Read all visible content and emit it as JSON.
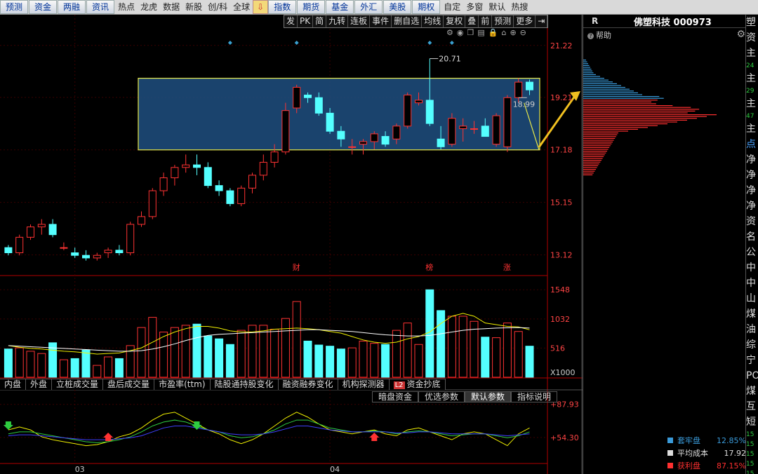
{
  "toolbar": {
    "buttons": [
      "预测",
      "资金",
      "两融",
      "资讯"
    ],
    "plain": [
      "热点",
      "龙虎",
      "数据",
      "新股",
      "创/科",
      "全球"
    ],
    "buttons2": [
      "指数",
      "期货",
      "基金",
      "外汇",
      "美股",
      "期权"
    ],
    "plain2": [
      "自定",
      "多窗",
      "默认",
      "热搜"
    ]
  },
  "chart_toolbar": [
    "发",
    "PK",
    "简",
    "九转",
    "连板",
    "事件",
    "删自选",
    "均线",
    "复权",
    "叠",
    "前",
    "预测",
    "更多"
  ],
  "icons": [
    "settings-icon",
    "eye-icon",
    "copy-icon",
    "print-icon",
    "lock-icon",
    "home-icon",
    "zoom-in-icon",
    "zoom-out-icon"
  ],
  "price_axis": [
    "21.22",
    "19.21",
    "17.18",
    "15.15",
    "13.12"
  ],
  "annotations": {
    "high": "20.71",
    "last": "18.99",
    "markers": [
      "财",
      "榜",
      "涨"
    ]
  },
  "volume_axis": [
    "1548",
    "1032",
    "516",
    "X1000"
  ],
  "osc_axis": [
    "+87.93",
    "+54.30"
  ],
  "date_labels": [
    "03",
    "04"
  ],
  "indicator_tabs": [
    "内盘",
    "外盘",
    "立桩成交量",
    "盘后成交量",
    "市盈率(ttm)",
    "陆股通持股变化",
    "融资融券变化",
    "机构探测器",
    "资金抄底"
  ],
  "l2_badge": "L2",
  "sub_tabs": [
    "暗盘资金",
    "优选参数",
    "默认参数",
    "指标说明"
  ],
  "right_panel": {
    "r_label": "R",
    "stock_name": "佛塑科技 000973",
    "help": "帮助",
    "legend": [
      {
        "label": "套牢盘",
        "value": "12.85%",
        "color": "#3a9ad9"
      },
      {
        "label": "平均成本",
        "value": "17.92",
        "color": "#dddddd"
      },
      {
        "label": "获利盘",
        "value": "87.15%",
        "color": "#ff3030"
      }
    ]
  },
  "far_right": [
    "塑",
    "资",
    "主",
    "24",
    "主",
    "29",
    "主",
    "47",
    "主",
    "点",
    "净",
    "净",
    "净",
    "净",
    "资",
    "名",
    "公",
    "中",
    "中",
    "山",
    "煤",
    "油",
    "综",
    "宁",
    "PO",
    "煤",
    "互",
    "短",
    "15",
    "15",
    "15",
    "15",
    "15"
  ],
  "colors": {
    "up": "#ff3333",
    "down": "#54ffff",
    "box_fill": "#1f4f80",
    "box_border": "#e8e84a",
    "arrow": "#f0c020"
  },
  "chart_data": {
    "type": "candlestick",
    "candles": [
      [
        13.4,
        13.5,
        13.1,
        13.2
      ],
      [
        13.2,
        13.9,
        13.1,
        13.8
      ],
      [
        13.8,
        14.3,
        13.7,
        14.2
      ],
      [
        14.2,
        14.5,
        13.9,
        14.3
      ],
      [
        14.3,
        14.5,
        13.8,
        13.9
      ],
      [
        13.4,
        13.6,
        13.3,
        13.4
      ],
      [
        13.2,
        13.4,
        13.0,
        13.1
      ],
      [
        13.1,
        13.3,
        12.9,
        13.0
      ],
      [
        13.0,
        13.2,
        12.9,
        13.1
      ],
      [
        13.2,
        13.4,
        13.0,
        13.3
      ],
      [
        13.3,
        13.5,
        13.1,
        13.2
      ],
      [
        13.2,
        14.4,
        13.1,
        14.3
      ],
      [
        14.3,
        14.8,
        14.2,
        14.6
      ],
      [
        14.6,
        15.7,
        14.5,
        15.6
      ],
      [
        15.6,
        16.3,
        15.4,
        16.1
      ],
      [
        16.1,
        16.6,
        15.8,
        16.5
      ],
      [
        16.5,
        17.0,
        16.3,
        16.6
      ],
      [
        16.6,
        17.0,
        16.2,
        16.5
      ],
      [
        16.5,
        16.7,
        15.7,
        15.8
      ],
      [
        15.8,
        16.0,
        15.4,
        15.6
      ],
      [
        15.6,
        15.7,
        15.0,
        15.1
      ],
      [
        15.1,
        15.8,
        15.0,
        15.7
      ],
      [
        15.7,
        16.3,
        15.5,
        16.2
      ],
      [
        16.2,
        17.0,
        16.0,
        16.7
      ],
      [
        16.7,
        17.4,
        16.5,
        17.1
      ],
      [
        17.1,
        19.0,
        17.0,
        18.7
      ],
      [
        18.8,
        19.7,
        18.6,
        19.6
      ],
      [
        19.3,
        19.4,
        19.0,
        19.2
      ],
      [
        19.2,
        19.4,
        18.5,
        18.6
      ],
      [
        18.6,
        18.8,
        17.8,
        17.9
      ],
      [
        17.9,
        18.1,
        17.3,
        17.6
      ],
      [
        17.3,
        17.6,
        17.0,
        17.3
      ],
      [
        17.4,
        17.6,
        17.0,
        17.5
      ],
      [
        17.5,
        17.9,
        17.2,
        17.8
      ],
      [
        17.7,
        17.9,
        17.3,
        17.4
      ],
      [
        17.6,
        18.2,
        17.4,
        18.1
      ],
      [
        18.1,
        19.4,
        18.0,
        19.3
      ],
      [
        19.0,
        19.4,
        18.9,
        19.1
      ],
      [
        19.1,
        20.71,
        18.1,
        18.2
      ],
      [
        17.6,
        18.1,
        17.2,
        17.3
      ],
      [
        17.4,
        18.6,
        17.3,
        18.4
      ],
      [
        18.0,
        18.4,
        17.5,
        18.1
      ],
      [
        18.0,
        18.3,
        17.8,
        18.0
      ],
      [
        18.1,
        18.4,
        17.7,
        17.7
      ],
      [
        17.4,
        18.6,
        17.3,
        18.5
      ],
      [
        17.3,
        19.3,
        17.1,
        19.2
      ],
      [
        19.2,
        19.95,
        19.0,
        19.8
      ],
      [
        19.8,
        19.9,
        19.3,
        19.5
      ]
    ],
    "volume": [
      500,
      520,
      460,
      420,
      610,
      310,
      330,
      480,
      210,
      360,
      330,
      560,
      880,
      1060,
      800,
      880,
      920,
      940,
      730,
      680,
      580,
      830,
      920,
      920,
      850,
      1040,
      1340,
      640,
      570,
      550,
      500,
      520,
      640,
      600,
      580,
      830,
      960,
      580,
      1548,
      1180,
      1080,
      1080,
      990,
      710,
      700,
      960,
      810,
      550
    ],
    "ma": [
      {
        "name": "MA5",
        "color": "#f0f000",
        "values": [
          560,
          530,
          510,
          500,
          480,
          460,
          450,
          430,
          410,
          420,
          430,
          470,
          520,
          620,
          720,
          800,
          860,
          900,
          900,
          870,
          820,
          800,
          800,
          820,
          850,
          860,
          870,
          860,
          840,
          810,
          780,
          720,
          660,
          620,
          600,
          620,
          680,
          720,
          800,
          950,
          1080,
          1130,
          1080,
          960,
          930,
          900,
          890,
          840
        ]
      },
      {
        "name": "MA10",
        "color": "#ffffff",
        "values": [
          560,
          550,
          540,
          530,
          520,
          510,
          500,
          490,
          480,
          470,
          460,
          460,
          470,
          500,
          540,
          590,
          650,
          700,
          740,
          760,
          770,
          780,
          790,
          800,
          810,
          820,
          830,
          840,
          840,
          830,
          820,
          810,
          790,
          770,
          750,
          740,
          730,
          730,
          740,
          770,
          800,
          830,
          850,
          860,
          870,
          875,
          880,
          870
        ]
      }
    ],
    "oscillator": [
      {
        "name": "K",
        "color": "#f0f000",
        "values": [
          62,
          65,
          62,
          55,
          52,
          50,
          48,
          46,
          47,
          50,
          55,
          58,
          64,
          72,
          78,
          80,
          74,
          68,
          62,
          58,
          52,
          48,
          52,
          58,
          66,
          74,
          80,
          75,
          68,
          62,
          60,
          58,
          60,
          62,
          58,
          56,
          62,
          64,
          60,
          56,
          52,
          58,
          60,
          58,
          52,
          46,
          58,
          64
        ]
      },
      {
        "name": "D",
        "color": "#2ecc40",
        "values": [
          58,
          60,
          60,
          58,
          56,
          54,
          52,
          50,
          49,
          50,
          52,
          55,
          60,
          66,
          70,
          72,
          70,
          66,
          62,
          60,
          56,
          54,
          55,
          58,
          62,
          68,
          72,
          72,
          68,
          64,
          62,
          60,
          60,
          61,
          60,
          58,
          60,
          61,
          60,
          58,
          56,
          57,
          58,
          58,
          56,
          54,
          56,
          60
        ]
      },
      {
        "name": "J",
        "color": "#4040ff",
        "values": [
          56,
          57,
          57,
          56,
          55,
          54,
          53,
          52,
          52,
          52,
          53,
          54,
          56,
          60,
          64,
          66,
          66,
          64,
          62,
          60,
          58,
          57,
          57,
          58,
          60,
          63,
          66,
          66,
          64,
          62,
          61,
          60,
          60,
          60,
          60,
          59,
          59,
          60,
          60,
          59,
          58,
          58,
          58,
          58,
          57,
          56,
          57,
          58
        ]
      }
    ],
    "box": {
      "low": 17.18,
      "high": 19.95,
      "from_index": 25,
      "to_index": 47
    },
    "ylim": [
      12.4,
      22.0
    ],
    "vol_ylim": [
      0,
      1700
    ],
    "osc_ylim": [
      35,
      92
    ]
  }
}
